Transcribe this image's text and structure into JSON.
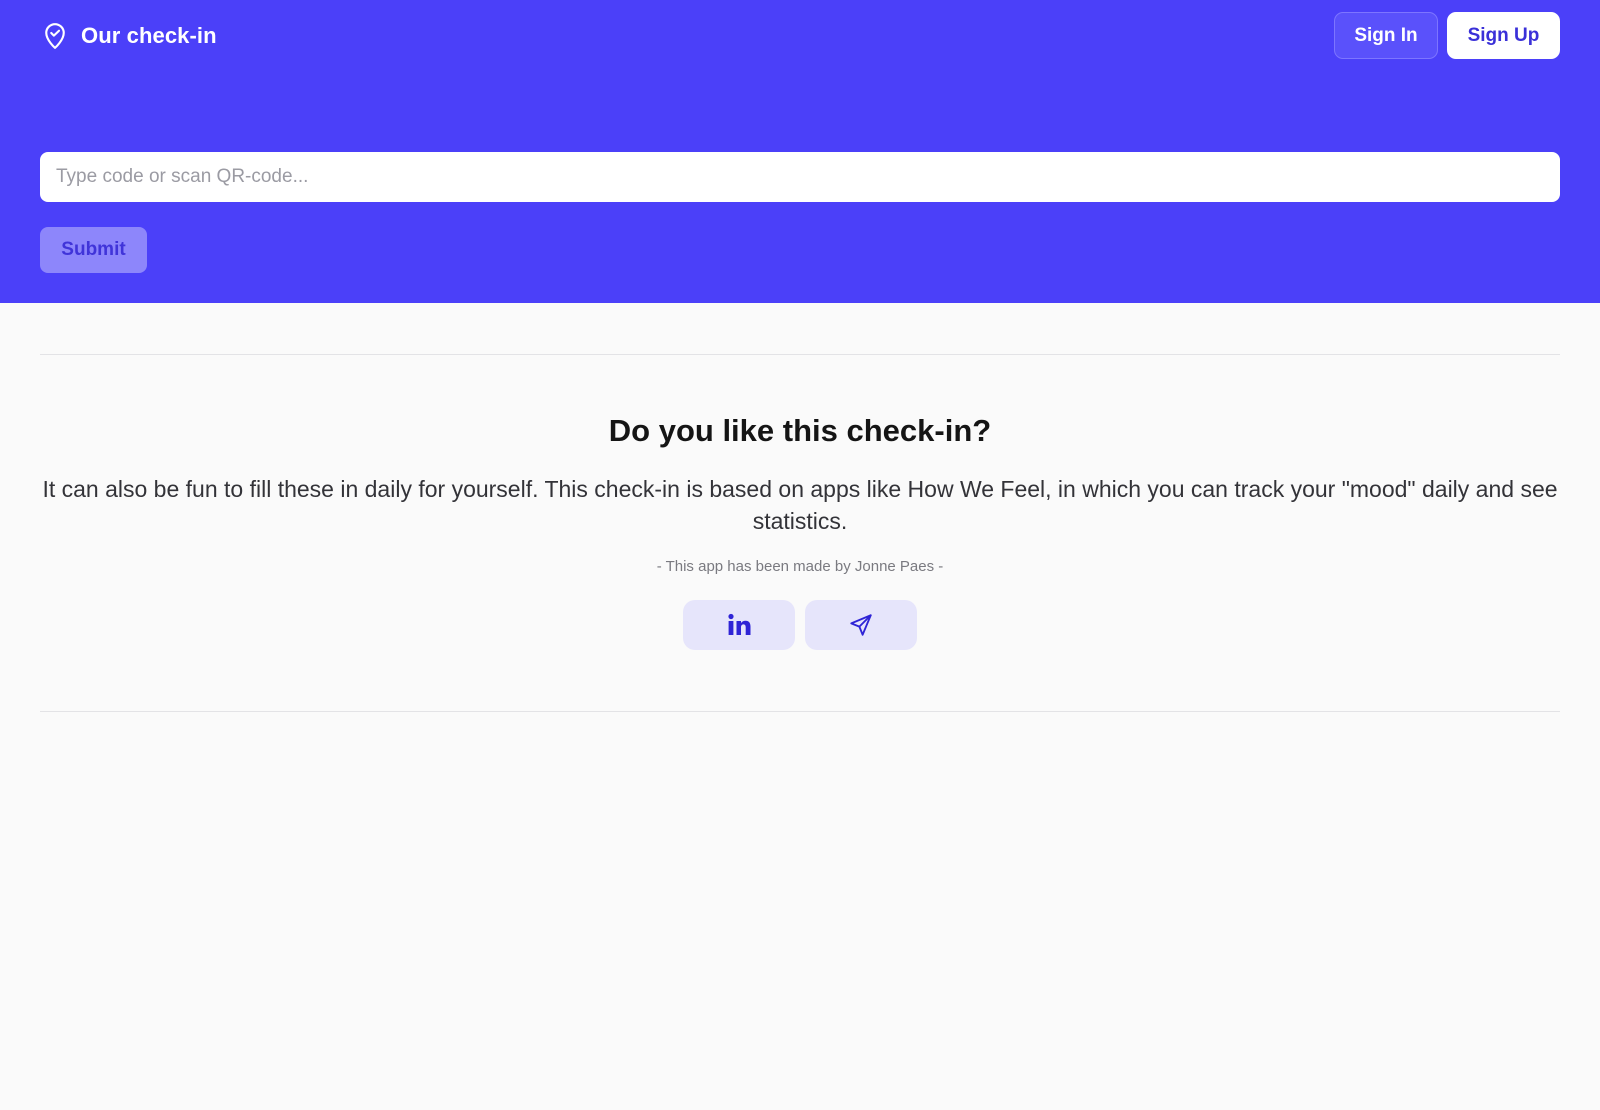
{
  "header": {
    "app_title": "Our check-in",
    "brand_icon": "map-pin-check-icon",
    "sign_in_label": "Sign In",
    "sign_up_label": "Sign Up"
  },
  "checkin_form": {
    "code_placeholder": "Type code or scan QR-code...",
    "code_value": "",
    "submit_label": "Submit"
  },
  "promo": {
    "heading": "Do you like this check-in?",
    "text": "It can also be fun to fill these in daily for yourself. This check-in is based on apps like How We Feel, in which you can track your \"mood\" daily and see statistics.",
    "credit": "- This app has been made by Jonne Paes -",
    "social_links": [
      {
        "icon": "linkedin-icon"
      },
      {
        "icon": "send-icon"
      }
    ]
  },
  "colors": {
    "primary": "#4b40f9",
    "page_background": "#fafafa",
    "accent_text": "#3a30d8",
    "social_button_bg": "#e6e5fb"
  }
}
